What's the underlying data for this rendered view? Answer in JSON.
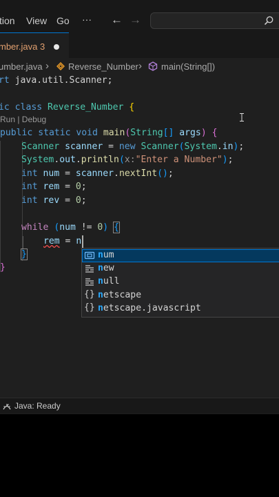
{
  "menu": {
    "item_tion": "tion",
    "item_view": "View",
    "item_go": "Go",
    "more": "···"
  },
  "nav": {
    "back": "←",
    "forward": "→"
  },
  "tab": {
    "label": "mber.java 3",
    "modified": true
  },
  "breadcrumb": {
    "file": "umber.java",
    "sep": "›",
    "class": "Reverse_Number",
    "method": "main(String[])"
  },
  "codelens": "Run | Debug",
  "code": {
    "l1": {
      "kw": "rt",
      "rest": " java.util.Scanner;"
    },
    "l2": {
      "kw1": "ic",
      "kw2": "class",
      "name": "Reverse_Number",
      "brace": "{"
    },
    "l3": {
      "kw1": "public",
      "kw2": "static",
      "kw3": "void",
      "fn": "main",
      "p1": "(",
      "type": "String",
      "arr": "[]",
      "param": "args",
      "p2": ")",
      "brace": "{"
    },
    "l4": {
      "type1": "Scanner",
      "var": "scanner",
      "op": " = ",
      "kw": "new",
      "type2": "Scanner",
      "p1": "(",
      "cls": "System",
      "dot": ".",
      "field": "in",
      "p2": ")",
      "end": ";"
    },
    "l5": {
      "cls": "System",
      "dot1": ".",
      "field": "out",
      "dot2": ".",
      "fn": "println",
      "p1": "(",
      "hint": "x:",
      "str": "\"Enter a Number\"",
      "p2": ")",
      "end": ";"
    },
    "l6": {
      "kw": "int",
      "var1": "num",
      "op": " = ",
      "var2": "scanner",
      "dot": ".",
      "fn": "nextInt",
      "parens": "()",
      "end": ";"
    },
    "l7": {
      "kw": "int",
      "var": "rem",
      "op": " = ",
      "num": "0",
      "end": ";"
    },
    "l8": {
      "kw": "int",
      "var": "rev",
      "op": " = ",
      "num": "0",
      "end": ";"
    },
    "l9": {
      "kw": "while",
      "p1": "(",
      "var": "num",
      "op": " != ",
      "num": "0",
      "p2": ")",
      "brace": "{"
    },
    "l10": {
      "var": "rem",
      "op": " = ",
      "typed": "n"
    },
    "l11": {
      "brace": "}"
    },
    "l12": {
      "brace": "}"
    }
  },
  "suggestions": [
    {
      "match": "n",
      "rest": "um",
      "kind": "variable",
      "icon": "variable-icon"
    },
    {
      "match": "n",
      "rest": "ew",
      "kind": "keyword",
      "icon": "keyword-icon"
    },
    {
      "match": "n",
      "rest": "ull",
      "kind": "keyword",
      "icon": "keyword-icon"
    },
    {
      "match": "n",
      "rest": "etscape",
      "kind": "module",
      "icon": "module-icon"
    },
    {
      "match": "n",
      "rest": "etscape.javascript",
      "kind": "module",
      "icon": "module-icon"
    }
  ],
  "status": {
    "text": "Java: Ready",
    "icon": "java-status-icon"
  },
  "colors": {
    "editor_bg": "#1f1f1f",
    "chrome_bg": "#181818",
    "accent": "#0078d4",
    "keyword": "#569cd6",
    "type": "#4ec9b0",
    "function": "#dcdcaa",
    "variable": "#9cdcfe",
    "string": "#ce9178"
  }
}
